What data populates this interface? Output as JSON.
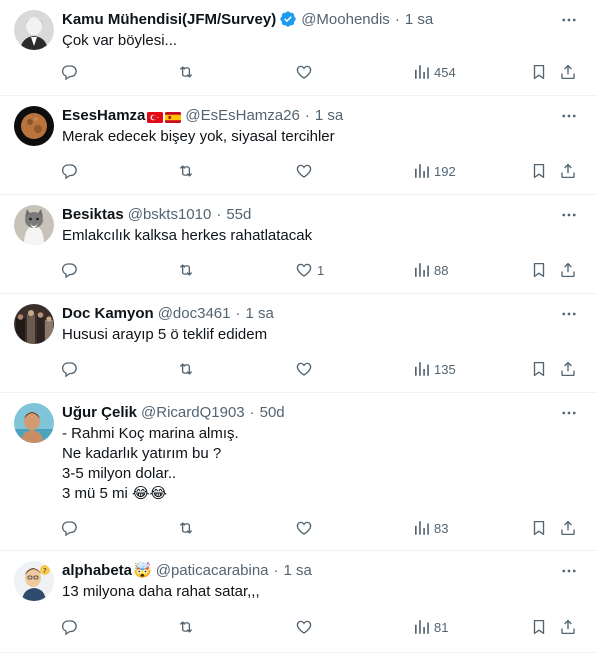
{
  "tweets": [
    {
      "name": "Kamu Mühendisi(JFM/Survey)",
      "handle": "@Moohendis",
      "time": "1 sa",
      "text": "Çok var böylesi...",
      "replies": "",
      "retweets": "",
      "likes": "",
      "views": "454",
      "verified": true,
      "avatar": "bw-portrait-avatar"
    },
    {
      "name": "EsesHamza",
      "handle": "@EsEsHamza26",
      "time": "1 sa",
      "text": "Merak edecek bişey yok, siyasal tercihler",
      "replies": "",
      "retweets": "",
      "likes": "",
      "views": "192",
      "flags": [
        "turkey-flag",
        "spain-flag"
      ],
      "avatar": "moon-avatar"
    },
    {
      "name": "Besiktas",
      "handle": "@bskts1010",
      "time": "55d",
      "text": "Emlakcılık kalksa herkes rahatlatacak",
      "replies": "",
      "retweets": "",
      "likes": "1",
      "views": "88",
      "avatar": "cat-avatar"
    },
    {
      "name": "Doc Kamyon",
      "handle": "@doc3461",
      "time": "1 sa",
      "text": "Hususi arayıp 5 ö teklif edidem",
      "replies": "",
      "retweets": "",
      "likes": "",
      "views": "135",
      "avatar": "group-photo-avatar"
    },
    {
      "name": "Uğur Çelik",
      "handle": "@RicardQ1903",
      "time": "50d",
      "text": "- Rahmi Koç marina almış.\nNe kadarlık yatırım bu ?\n3-5 milyon dolar..\n3 mü 5 mi 😂😂",
      "replies": "",
      "retweets": "",
      "likes": "",
      "views": "83",
      "avatar": "man-pool-avatar"
    },
    {
      "name": "alphabeta",
      "name_emoji": "🤯",
      "handle": "@paticacarabina",
      "time": "1 sa",
      "text": "13 milyona daha rahat satar,,,",
      "replies": "",
      "retweets": "",
      "likes": "",
      "views": "81",
      "avatar": "cartoon-avatar"
    }
  ],
  "dot": "·",
  "colors": {
    "muted": "#536471",
    "text": "#0f1419",
    "verified": "#1d9bf0",
    "divider": "#eff3f4"
  }
}
